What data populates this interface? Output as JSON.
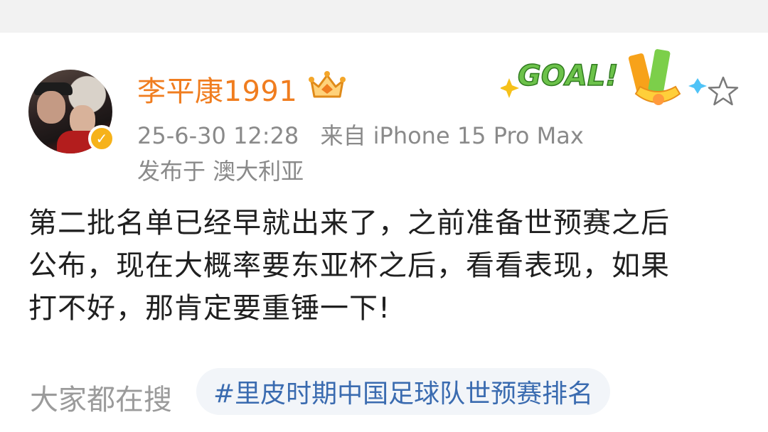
{
  "post": {
    "username": "李平康1991",
    "timestamp": "25-6-30 12:28",
    "source": "来自 iPhone 15 Pro Max",
    "location": "发布于 澳大利亚",
    "badge_text": "GOAL!",
    "content_lines": [
      "第二批名单已经早就出来了，之前准备世预赛之后",
      "公布，现在大概率要东亚杯之后，看看表现，如果",
      "打不好，那肯定要重锤一下!"
    ]
  },
  "footer": {
    "search_label": "大家都在搜",
    "topic": "#里皮时期中国足球队世预赛排名"
  },
  "icons": {
    "verified": "verified-badge-icon",
    "crown": "crown-icon",
    "star": "star-icon"
  },
  "colors": {
    "username": "#f07d1f",
    "meta": "#8a8a8a",
    "topic_link": "#3a6bb0",
    "verified": "#f6b21a",
    "goal_green": "#6cc24a"
  }
}
